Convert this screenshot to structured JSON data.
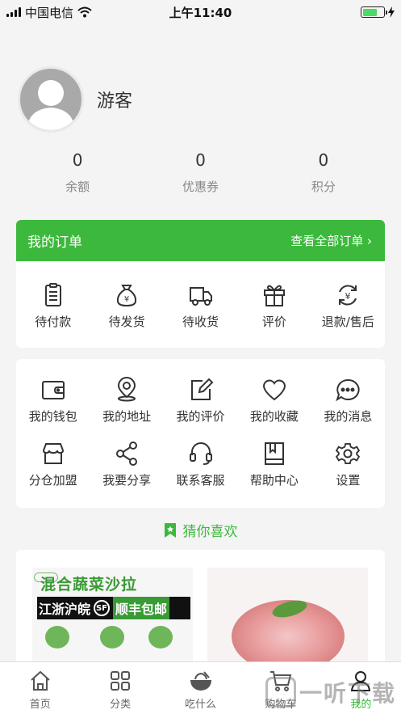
{
  "status_bar": {
    "carrier": "中国电信",
    "time": "上午11:40"
  },
  "profile": {
    "username": "游客"
  },
  "stats": [
    {
      "value": "0",
      "label": "余额"
    },
    {
      "value": "0",
      "label": "优惠券"
    },
    {
      "value": "0",
      "label": "积分"
    }
  ],
  "orders": {
    "title": "我的订单",
    "view_all": "查看全部订单",
    "items": [
      {
        "label": "待付款",
        "icon": "clipboard-icon"
      },
      {
        "label": "待发货",
        "icon": "money-bag-icon"
      },
      {
        "label": "待收货",
        "icon": "truck-icon"
      },
      {
        "label": "评价",
        "icon": "gift-icon"
      },
      {
        "label": "退款/售后",
        "icon": "refund-icon"
      }
    ]
  },
  "tools": {
    "row1": [
      {
        "label": "我的钱包",
        "icon": "wallet-icon"
      },
      {
        "label": "我的地址",
        "icon": "location-icon"
      },
      {
        "label": "我的评价",
        "icon": "edit-icon"
      },
      {
        "label": "我的收藏",
        "icon": "heart-icon"
      },
      {
        "label": "我的消息",
        "icon": "message-icon"
      }
    ],
    "row2": [
      {
        "label": "分仓加盟",
        "icon": "store-icon"
      },
      {
        "label": "我要分享",
        "icon": "share-icon"
      },
      {
        "label": "联系客服",
        "icon": "headset-icon"
      },
      {
        "label": "帮助中心",
        "icon": "book-icon"
      },
      {
        "label": "设置",
        "icon": "gear-icon"
      }
    ]
  },
  "recommend": {
    "title": "猜你喜欢"
  },
  "products": [
    {
      "title": "混合蔬菜沙拉",
      "banner_left": "江浙沪皖",
      "banner_logo": "SF",
      "banner_right": "顺丰包邮"
    },
    {
      "image": "sliced-meat"
    }
  ],
  "tabbar": [
    {
      "label": "首页",
      "icon": "home-icon"
    },
    {
      "label": "分类",
      "icon": "grid-icon"
    },
    {
      "label": "吃什么",
      "icon": "bowl-icon"
    },
    {
      "label": "购物车",
      "icon": "cart-icon"
    },
    {
      "label": "我的",
      "icon": "user-icon",
      "active": true
    }
  ],
  "watermark": "一听下载",
  "colors": {
    "accent": "#3cb93c",
    "background": "#f4f4f4"
  }
}
